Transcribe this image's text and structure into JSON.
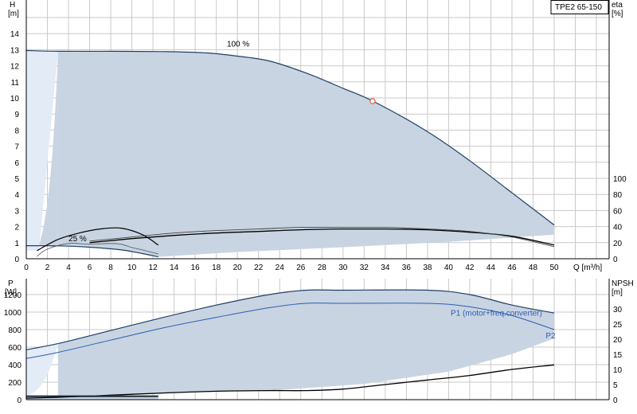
{
  "model_label": "TPE2 65-150",
  "colors": {
    "area_fill": "#c8d4e2",
    "area_fill_light": "#e2ebf6",
    "grid": "#c9c9c9",
    "curve_dark": "#1f3f66",
    "curve_blue": "#2a5cb0",
    "curve_black": "#000000",
    "duty_point": "#e06040"
  },
  "chart_data": [
    {
      "type": "line",
      "name": "head-efficiency",
      "x_axis": {
        "label": "Q [m³/h]",
        "range": [
          0,
          50
        ],
        "ticks": [
          0,
          2,
          4,
          6,
          8,
          10,
          12,
          14,
          16,
          18,
          20,
          22,
          24,
          26,
          28,
          30,
          32,
          34,
          36,
          38,
          40,
          42,
          44,
          46,
          48,
          50
        ]
      },
      "y_left": {
        "label_top": "H",
        "label_unit": "[m]",
        "range": [
          0,
          15
        ],
        "ticks": [
          0,
          1,
          2,
          3,
          4,
          5,
          6,
          7,
          8,
          9,
          10,
          11,
          12,
          13,
          14
        ]
      },
      "y_right": {
        "label_top": "eta",
        "label_unit": "[%]",
        "range": [
          0,
          150
        ],
        "ticks": [
          0,
          20,
          40,
          60,
          80,
          100
        ]
      },
      "grid": true,
      "annotations": [
        {
          "text": "100 %",
          "x": 19,
          "y": 13.2
        },
        {
          "text": "25 %",
          "x": 4.0,
          "y": 1.1
        }
      ],
      "duty_point": {
        "x": 32.8,
        "y": 9.8
      },
      "series": [
        {
          "key": "h100",
          "axis": "left",
          "x": [
            0,
            3,
            8,
            13,
            17,
            20,
            23,
            26.5,
            30,
            33,
            38,
            42,
            46,
            50
          ],
          "y": [
            12.95,
            12.9,
            12.9,
            12.88,
            12.8,
            12.6,
            12.3,
            11.55,
            10.6,
            9.75,
            7.9,
            6.1,
            4.1,
            2.1
          ]
        },
        {
          "key": "h25",
          "axis": "left",
          "x": [
            0,
            3,
            6,
            9,
            11,
            12.5
          ],
          "y": [
            0.81,
            0.8,
            0.72,
            0.55,
            0.32,
            0.12
          ]
        },
        {
          "key": "eta_total",
          "axis": "right",
          "x": [
            6,
            10,
            14,
            18,
            22,
            26,
            30,
            34,
            38,
            42,
            46,
            50
          ],
          "y": [
            20,
            25,
            29,
            32,
            34,
            36,
            37,
            37,
            36,
            33,
            28,
            17
          ]
        },
        {
          "key": "eta_pump",
          "axis": "right",
          "x": [
            6,
            10,
            14,
            18,
            22,
            26,
            30,
            34,
            38,
            42,
            46,
            50
          ],
          "y": [
            22,
            27,
            32,
            35,
            37,
            39,
            39,
            39,
            37,
            34,
            27,
            15
          ]
        },
        {
          "key": "eta25_total",
          "axis": "right",
          "x": [
            1,
            3,
            5,
            7,
            9,
            11,
            12.5
          ],
          "y": [
            10,
            24,
            32,
            37,
            38,
            30,
            17
          ]
        },
        {
          "key": "eta25_thin",
          "axis": "right",
          "x": [
            1,
            2,
            4,
            6,
            8,
            9,
            10,
            11,
            12.5
          ],
          "y": [
            3,
            12,
            19,
            18,
            19,
            18,
            14,
            11,
            6
          ]
        }
      ]
    },
    {
      "type": "line",
      "name": "power-npsh",
      "x_axis": {
        "range": [
          0,
          50
        ]
      },
      "y_left": {
        "label_top": "P",
        "label_unit": "[W]",
        "range": [
          0,
          1400
        ],
        "ticks": [
          0,
          200,
          400,
          600,
          800,
          1000,
          1200
        ]
      },
      "y_right": {
        "label_top": "NPSH",
        "label_unit": "[m]",
        "range": [
          0,
          35
        ],
        "ticks": [
          0,
          5,
          10,
          15,
          20,
          25,
          30
        ]
      },
      "grid": true,
      "annotations": [
        {
          "text": "P1 (motor+freq.converter)",
          "x": 40.2,
          "y": 960
        },
        {
          "text": "P2",
          "x": 49.2,
          "y": 700
        }
      ],
      "series": [
        {
          "key": "p1_100",
          "axis": "left",
          "x": [
            0,
            3,
            8,
            13,
            18,
            23,
            26.5,
            30,
            38,
            42,
            46,
            50
          ],
          "y": [
            570,
            640,
            790,
            940,
            1080,
            1200,
            1250,
            1250,
            1250,
            1200,
            1080,
            990
          ]
        },
        {
          "key": "p2_100",
          "axis": "left",
          "x": [
            0,
            3,
            8,
            13,
            18,
            23,
            26.5,
            30,
            38,
            42,
            46,
            50
          ],
          "y": [
            470,
            540,
            680,
            820,
            940,
            1050,
            1100,
            1100,
            1100,
            1060,
            960,
            800
          ]
        },
        {
          "key": "npsh",
          "axis": "right",
          "x": [
            0,
            3,
            8,
            13,
            18,
            23,
            26.5,
            30,
            34,
            38,
            42,
            46,
            50
          ],
          "y": [
            0.5,
            0.8,
            1.5,
            2.2,
            2.8,
            3.0,
            3.0,
            3.5,
            5.0,
            6.5,
            8.0,
            10.0,
            11.5
          ]
        },
        {
          "key": "p1_25",
          "axis": "left",
          "x": [
            0,
            4,
            8,
            12.5
          ],
          "y": [
            45,
            45,
            45,
            45
          ]
        },
        {
          "key": "p2_25",
          "axis": "left",
          "x": [
            0,
            4,
            8,
            12.5
          ],
          "y": [
            35,
            35,
            35,
            35
          ]
        }
      ]
    }
  ]
}
